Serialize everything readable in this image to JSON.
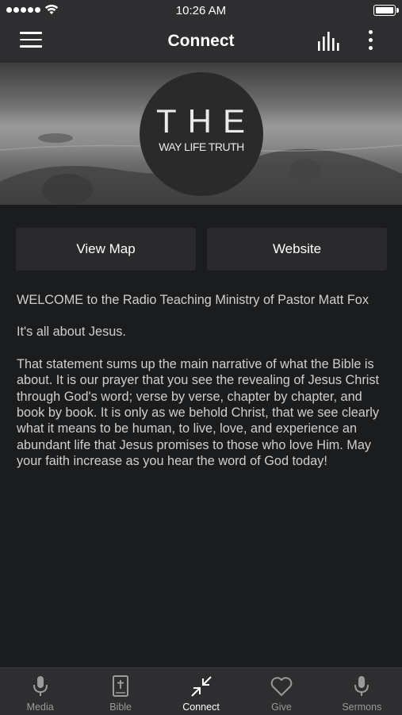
{
  "status_bar": {
    "time": "10:26 AM"
  },
  "nav": {
    "title": "Connect",
    "menu_icon": "hamburger-icon",
    "eq_icon": "equalizer-icon",
    "more_icon": "more-vertical-icon"
  },
  "header": {
    "logo_main": "THE",
    "logo_sub": "WAY LIFE TRUTH"
  },
  "buttons": {
    "view_map": "View Map",
    "website": "Website"
  },
  "description": {
    "welcome": "WELCOME to the Radio Teaching Ministry of Pastor Matt Fox",
    "tagline": "It's all about Jesus.",
    "body": "That statement sums up the main narrative of what the Bible is about. It is our prayer that you see the revealing of Jesus Christ through God's word; verse by verse, chapter by chapter, and book by book. It is only as we behold Christ, that we see clearly what it means to be human, to live, love, and experience an abundant life that Jesus promises to those who love Him. May your faith increase as you hear the word of God today!"
  },
  "tabs": [
    {
      "label": "Media",
      "icon": "microphone-icon",
      "active": false
    },
    {
      "label": "Bible",
      "icon": "bible-icon",
      "active": false
    },
    {
      "label": "Connect",
      "icon": "connect-arrows-icon",
      "active": true
    },
    {
      "label": "Give",
      "icon": "heart-icon",
      "active": false
    },
    {
      "label": "Sermons",
      "icon": "microphone-icon",
      "active": false
    }
  ],
  "colors": {
    "background": "#1b1c1e",
    "bar": "#2e2e30",
    "button": "#2a2a2c",
    "text": "#cfcfcf",
    "active_tab": "#ffffff",
    "inactive_tab": "#9a9a9a"
  }
}
